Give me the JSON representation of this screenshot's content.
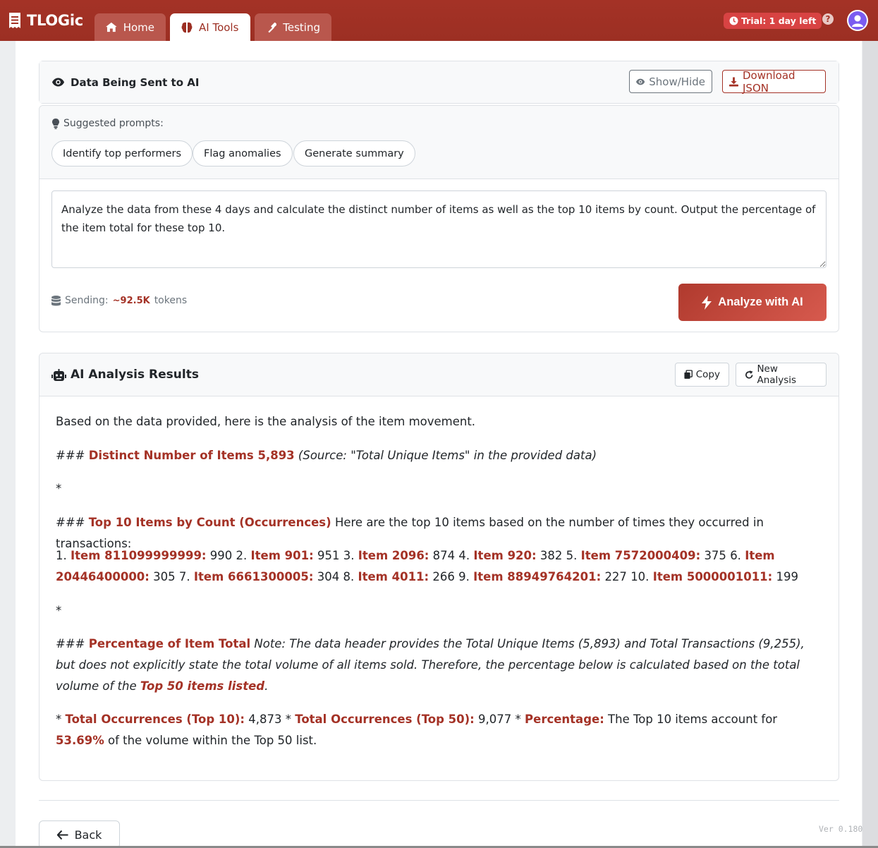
{
  "app": {
    "brand": "TLOGic"
  },
  "nav": {
    "tabs": [
      {
        "label": "Home",
        "icon": "home-icon"
      },
      {
        "label": "AI Tools",
        "icon": "brain-icon",
        "active": true
      },
      {
        "label": "Testing",
        "icon": "hammer-icon"
      }
    ],
    "trial_label": "Trial: 1 day left",
    "help_label": "?"
  },
  "data_panel": {
    "title": "Data Being Sent to AI",
    "show_hide_label": "Show/Hide",
    "download_label": "Download JSON"
  },
  "prompts": {
    "heading": "Suggested prompts:",
    "chips": [
      "Identify top performers",
      "Flag anomalies",
      "Generate summary"
    ],
    "input_value": "Analyze the data from these 4 days and calculate the distinct number of items as well as the top 10 items by count. Output the percentage of the item total for these top 10."
  },
  "sending": {
    "label": "Sending:",
    "value": "~92.5K",
    "unit": "tokens"
  },
  "analyze_label": "Analyze with AI",
  "results": {
    "title": "AI Analysis Results",
    "copy_label": "Copy",
    "new_label": "New Analysis",
    "intro": "Based on the data provided, here is the analysis of the item movement.",
    "h1_prefix": "###",
    "h1_bold": "Distinct Number of Items 5,893",
    "h1_italic": "(Source: \"Total Unique Items\" in the provided data)",
    "star": "*",
    "h2_prefix": "###",
    "h2_bold": "Top 10 Items by Count (Occurrences)",
    "h2_text": "Here are the top 10 items based on the number of times they occurred in transactions:",
    "items": [
      {
        "n": "1.",
        "name": "Item 811099999999:",
        "count": "990"
      },
      {
        "n": "2.",
        "name": "Item 901:",
        "count": "951"
      },
      {
        "n": "3.",
        "name": "Item 2096:",
        "count": "874"
      },
      {
        "n": "4.",
        "name": "Item 920:",
        "count": "382"
      },
      {
        "n": "5.",
        "name": "Item 7572000409:",
        "count": "375"
      },
      {
        "n": "6.",
        "name": "Item 20446400000:",
        "count": "305"
      },
      {
        "n": "7.",
        "name": "Item 6661300005:",
        "count": "304"
      },
      {
        "n": "8.",
        "name": "Item 4011:",
        "count": "266"
      },
      {
        "n": "9.",
        "name": "Item 88949764201:",
        "count": "227"
      },
      {
        "n": "10.",
        "name": "Item 5000001011:",
        "count": "199"
      }
    ],
    "h3_prefix": "###",
    "h3_bold": "Percentage of Item Total",
    "h3_italic": "Note: The data header provides the Total Unique Items (5,893) and Total Transactions (9,255), but does not explicitly state the total volume of all items sold. Therefore, the percentage below is calculated based on the total volume of the",
    "h3_bold_italic": "Top 50 items listed",
    "h3_end": ".",
    "t1_label": "Total Occurrences (Top 10):",
    "t1_value": "4,873",
    "t2_label": "Total Occurrences (Top 50):",
    "t2_value": "9,077",
    "pct_label": "Percentage:",
    "pct_text_a": "The Top 10 items account for",
    "pct_value": "53.69%",
    "pct_text_b": "of the volume within the Top 50 list."
  },
  "footer": {
    "back_label": "Back",
    "version": "Ver 0.180"
  },
  "colors": {
    "brand": "#a43226",
    "accent": "#d84343"
  }
}
